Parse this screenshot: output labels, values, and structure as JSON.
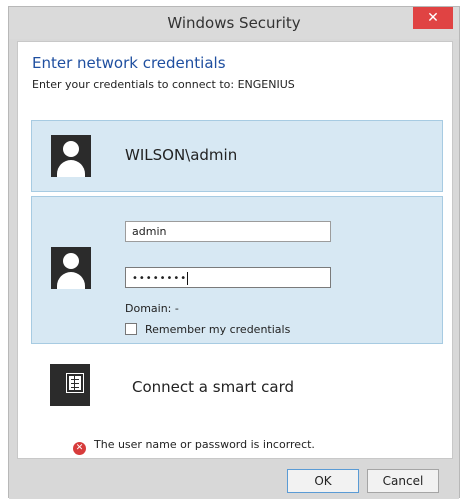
{
  "window": {
    "title": "Windows Security",
    "close_glyph": "✕"
  },
  "dialog": {
    "heading": "Enter network credentials",
    "subheading": "Enter your credentials to connect to: ENGENIUS"
  },
  "tiles": {
    "saved_account": {
      "name": "WILSON\\admin",
      "icon": "user-avatar-icon"
    },
    "login": {
      "icon": "user-avatar-icon",
      "username_value": "admin",
      "password_value": "••••••••",
      "domain_text": "Domain: -",
      "remember_label": "Remember my credentials",
      "remember_checked": false
    }
  },
  "smart_card": {
    "label": "Connect a smart card",
    "icon": "smart-card-icon"
  },
  "error": {
    "icon": "error-icon",
    "icon_glyph": "✕",
    "message": "The user name or password is incorrect."
  },
  "buttons": {
    "ok": "OK",
    "cancel": "Cancel"
  },
  "colors": {
    "accent_heading": "#1f4fa0",
    "tile_bg": "#d7e8f3",
    "close_button": "#e04343",
    "error": "#d73b3b"
  }
}
